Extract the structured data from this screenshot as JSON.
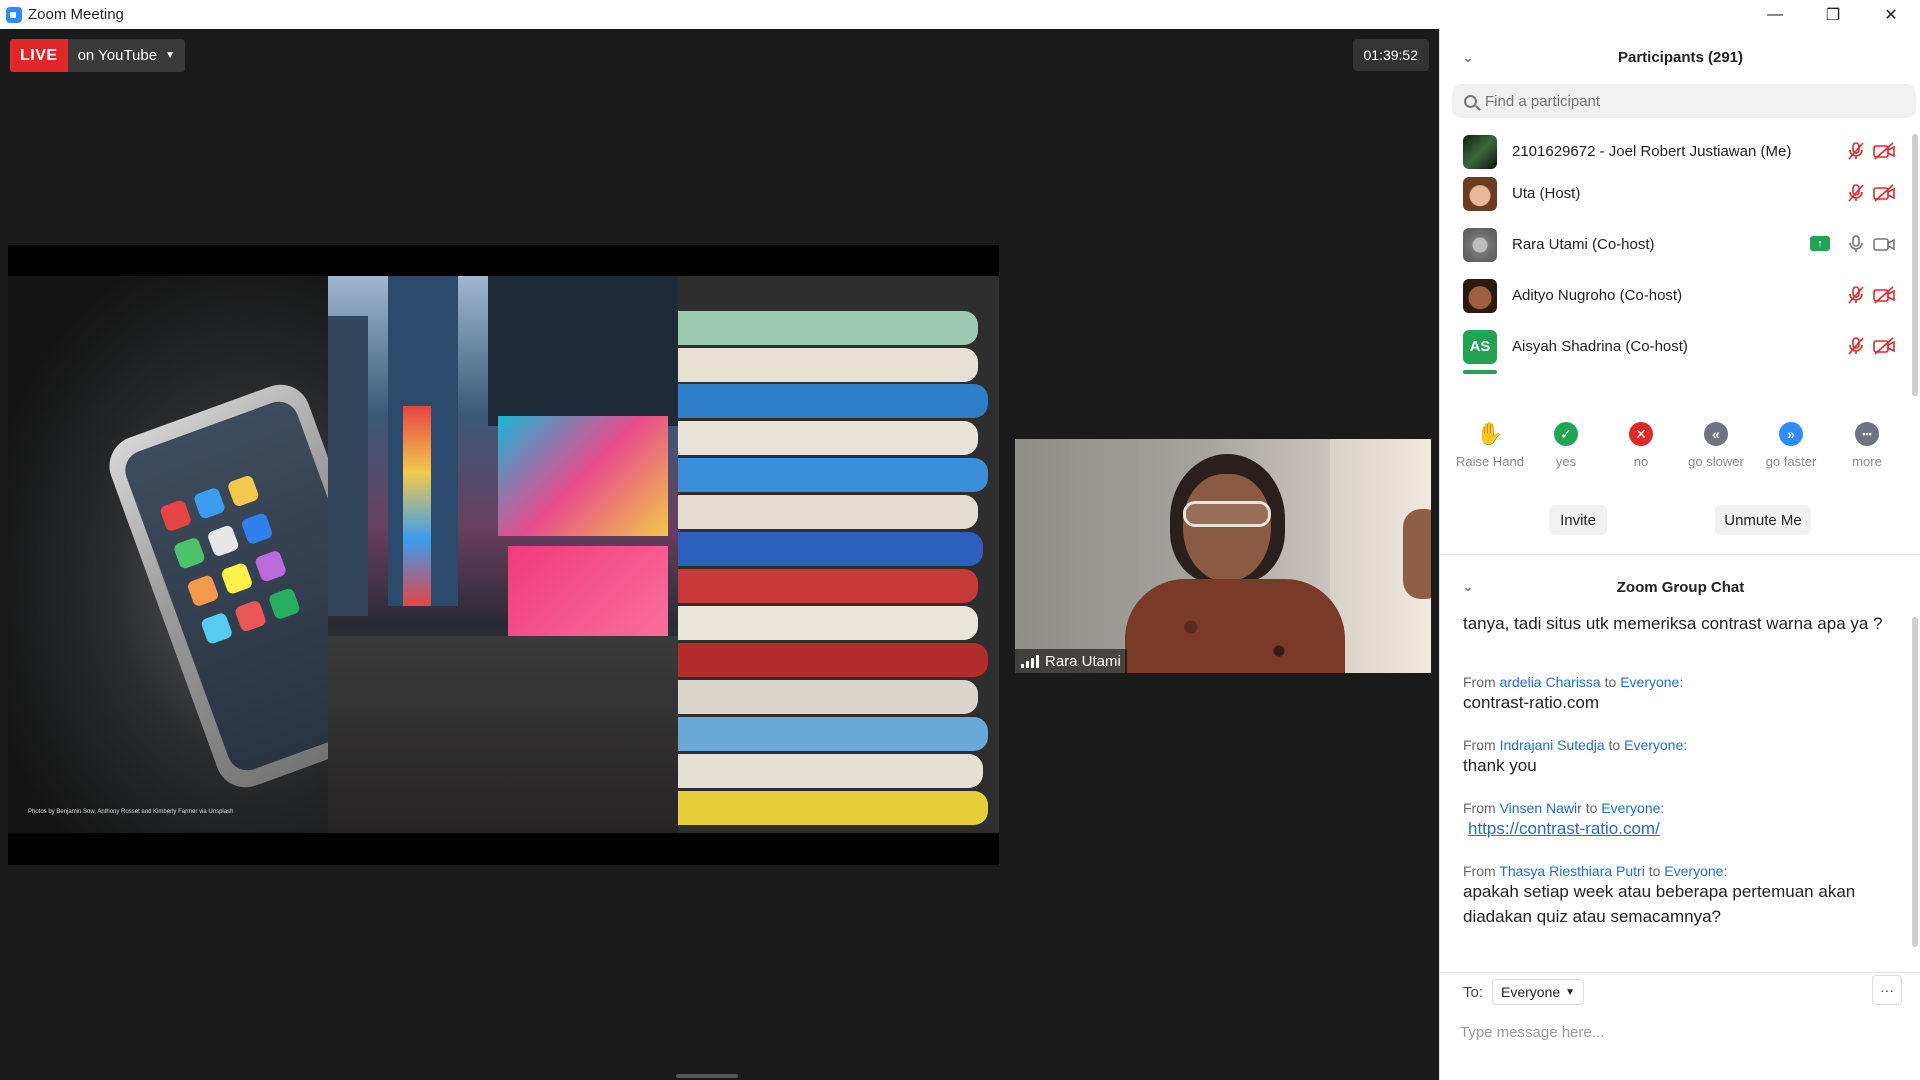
{
  "window": {
    "title": "Zoom Meeting",
    "controls": {
      "minimize": "—",
      "restore": "❐",
      "close": "✕"
    }
  },
  "stage": {
    "live_label": "LIVE",
    "stream_target": "on YouTube",
    "timer": "01:39:52",
    "slide_credit": "Photos by Benjamin Sow, Anthony Rosset and Kimberly Farmer via Unsplash",
    "video_tile": {
      "name": "Rara Utami"
    }
  },
  "participants": {
    "title": "Participants (291)",
    "search_placeholder": "Find a participant",
    "list": [
      {
        "name": "2101629672 - Joel Robert Justiawan (Me)",
        "avatar": "photo",
        "avatar_color": "#1f3a1f",
        "mic": "muted",
        "cam": "off"
      },
      {
        "name": "Uta (Host)",
        "avatar": "photo",
        "avatar_color": "#c48a6a",
        "mic": "muted",
        "cam": "off"
      },
      {
        "name": "Rara Utami (Co-host)",
        "avatar": "photo",
        "avatar_color": "#8a8a8a",
        "mic": "on",
        "cam": "on",
        "sharing": true
      },
      {
        "name": "Adityo Nugroho (Co-host)",
        "avatar": "photo",
        "avatar_color": "#6b3a22",
        "mic": "muted",
        "cam": "off"
      },
      {
        "name": "Aisyah Shadrina (Co-host)",
        "avatar": "AS",
        "avatar_color": "#23a455",
        "mic": "muted",
        "cam": "off"
      }
    ],
    "reactions": [
      {
        "label": "Raise Hand",
        "icon": "hand-icon",
        "color": "#2d8cff",
        "glyph": "✋"
      },
      {
        "label": "yes",
        "icon": "check-icon",
        "color": "#23a455",
        "glyph": "✓"
      },
      {
        "label": "no",
        "icon": "x-icon",
        "color": "#e02828",
        "glyph": "✕"
      },
      {
        "label": "go slower",
        "icon": "rewind-icon",
        "color": "#6e7480",
        "glyph": "«"
      },
      {
        "label": "go faster",
        "icon": "fast-forward-icon",
        "color": "#2d8cff",
        "glyph": "»"
      },
      {
        "label": "more",
        "icon": "more-icon",
        "color": "#6e7480",
        "glyph": "•••"
      }
    ],
    "invite_label": "Invite",
    "unmute_label": "Unmute Me"
  },
  "chat": {
    "title": "Zoom Group Chat",
    "messages": [
      {
        "from": "",
        "to": "",
        "text": "tanya, tadi situs utk memeriksa contrast warna apa ya ?"
      },
      {
        "from_prefix": "From",
        "from": "ardelia Charissa",
        "to_prefix": "to",
        "to": "Everyone:",
        "text": "contrast-ratio.com"
      },
      {
        "from_prefix": "From",
        "from": "Indrajani Sutedja",
        "to_prefix": "to",
        "to": "Everyone:",
        "text": "thank you"
      },
      {
        "from_prefix": "From",
        "from": "Vinsen Nawir",
        "to_prefix": "to",
        "to": "Everyone:",
        "text": "https://contrast-ratio.com/"
      },
      {
        "from_prefix": "From",
        "from": "Thasya Riesthiara Putri",
        "to_prefix": "to",
        "to": "Everyone:",
        "text": "apakah setiap week atau beberapa pertemuan akan diadakan quiz atau semacamnya?"
      }
    ],
    "to_label": "To:",
    "recipient": "Everyone",
    "input_placeholder": "Type message here...",
    "more_label": "···"
  }
}
